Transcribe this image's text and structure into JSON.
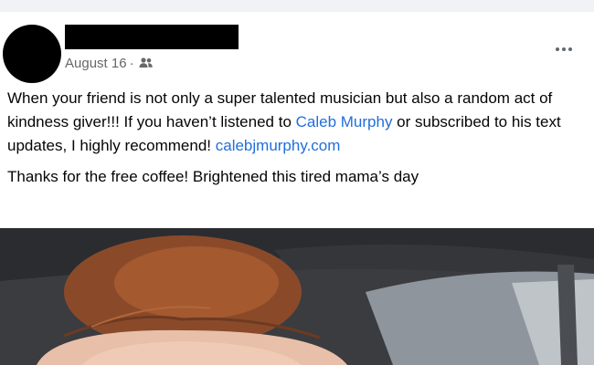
{
  "post": {
    "date": "August 16",
    "separator": "·",
    "audience_icon": "friends-icon",
    "more_icon": "more-horizontal-icon",
    "text": {
      "p1_before_link": "When your friend is not only a super talented musician but also a random act of kindness giver!!! If you haven’t listened to ",
      "link_name": "Caleb Murphy",
      "p1_after_link": " or subscribed to his text updates, I highly recommend! ",
      "link_url_text": "calebjmurphy.com",
      "p2": "Thanks for the free coffee! Brightened this tired mama’s day"
    },
    "colors": {
      "link": "#216fdb",
      "meta": "#65676b",
      "text": "#050505"
    }
  }
}
